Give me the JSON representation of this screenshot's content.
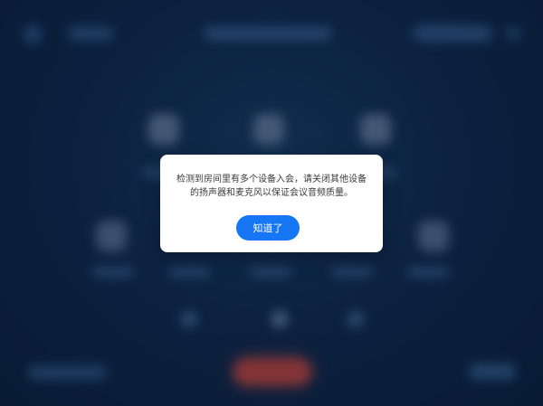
{
  "dialog": {
    "message": "检测到房间里有多个设备入会，请关闭其他设备的扬声器和麦克风以保证会议音频质量。",
    "confirm_label": "知道了"
  },
  "colors": {
    "background": "#0f2a4d",
    "dialog_background": "#ffffff",
    "primary_button": "#1776f3",
    "hangup_button": "#d84a3d"
  }
}
